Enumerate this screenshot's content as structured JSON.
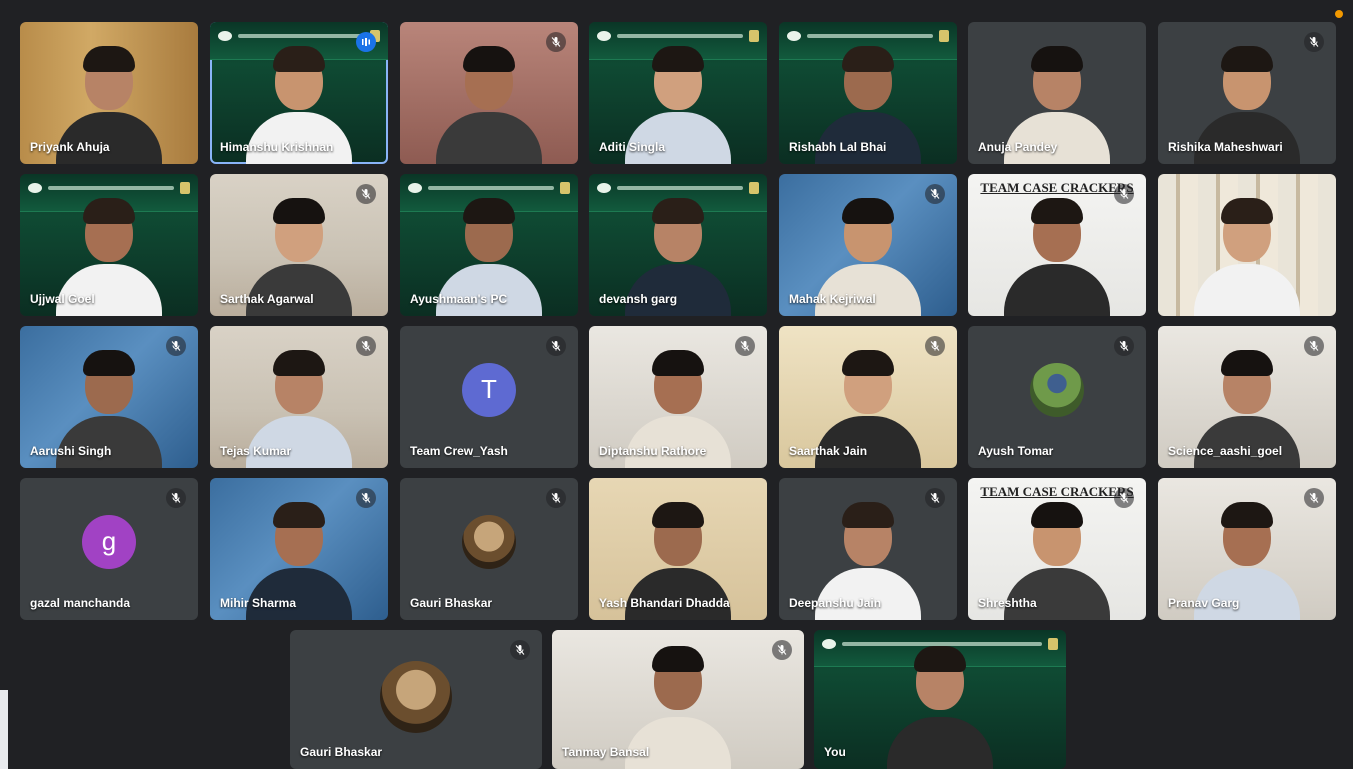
{
  "meeting": {
    "participants": [
      {
        "id": "p1",
        "name": "Priyank Ahuja",
        "bg": "wood",
        "muted": false
      },
      {
        "id": "p2",
        "name": "Himanshu Krishnan",
        "bg": "green",
        "muted": false,
        "active": true,
        "effect_icon": true
      },
      {
        "id": "p3",
        "name": "",
        "bg": "pink",
        "muted": true
      },
      {
        "id": "p4",
        "name": "Aditi Singla",
        "bg": "green",
        "muted": false
      },
      {
        "id": "p5",
        "name": "Rishabh Lal Bhai",
        "bg": "green",
        "muted": false
      },
      {
        "id": "p6",
        "name": "Anuja Pandey",
        "bg": "dark",
        "muted": false
      },
      {
        "id": "p7",
        "name": "Rishika Maheshwari",
        "bg": "dark",
        "muted": true
      },
      {
        "id": "p8",
        "name": "Ujjwal Goel",
        "bg": "green",
        "muted": false
      },
      {
        "id": "p9",
        "name": "Sarthak Agarwal",
        "bg": "room",
        "muted": true
      },
      {
        "id": "p10",
        "name": "Ayushmaan's PC",
        "bg": "green",
        "muted": false
      },
      {
        "id": "p11",
        "name": "devansh garg",
        "bg": "green",
        "muted": false
      },
      {
        "id": "p12",
        "name": "Mahak Kejriwal",
        "bg": "blue",
        "muted": true
      },
      {
        "id": "p13",
        "name": "",
        "bg": "white",
        "muted": true,
        "banner": "TEAM CASE CRACKERS"
      },
      {
        "id": "p14",
        "name": "",
        "bg": "shelf",
        "muted": false
      },
      {
        "id": "p15",
        "name": "Aarushi Singh",
        "bg": "blue",
        "muted": true
      },
      {
        "id": "p16",
        "name": "Tejas Kumar",
        "bg": "room",
        "muted": true
      },
      {
        "id": "p17",
        "name": "Team Crew_Yash",
        "bg": "dark",
        "muted": true,
        "initial": "T",
        "initial_color": "#5e6ad2"
      },
      {
        "id": "p18",
        "name": "Diptanshu Rathore",
        "bg": "office",
        "muted": true
      },
      {
        "id": "p19",
        "name": "Saarthak Jain",
        "bg": "gold",
        "muted": true
      },
      {
        "id": "p20",
        "name": "Ayush Tomar",
        "bg": "dark",
        "muted": true,
        "photo": "green"
      },
      {
        "id": "p21",
        "name": "Science_aashi_goel",
        "bg": "office",
        "muted": true
      },
      {
        "id": "p22",
        "name": "gazal manchanda",
        "bg": "dark",
        "muted": true,
        "initial": "g",
        "initial_color": "#a142c4"
      },
      {
        "id": "p23",
        "name": "Mihir Sharma",
        "bg": "blue",
        "muted": true
      },
      {
        "id": "p24",
        "name": "Gauri Bhaskar",
        "bg": "dark",
        "muted": true,
        "photo": "brown"
      },
      {
        "id": "p25",
        "name": "Yash Bhandari Dhadda",
        "bg": "warm",
        "muted": false
      },
      {
        "id": "p26",
        "name": "Deepanshu Jain",
        "bg": "dark",
        "muted": true
      },
      {
        "id": "p27",
        "name": "Shreshtha",
        "bg": "white",
        "muted": true,
        "banner": "TEAM CASE CRACKERS"
      },
      {
        "id": "p28",
        "name": "Pranav Garg",
        "bg": "office",
        "muted": true
      },
      {
        "id": "p29",
        "name": "Gauri Bhaskar",
        "bg": "dark",
        "muted": true,
        "photo": "brown"
      },
      {
        "id": "p30",
        "name": "Tanmay Bansal",
        "bg": "office",
        "muted": true
      },
      {
        "id": "p31",
        "name": "You",
        "bg": "green",
        "muted": false
      }
    ]
  }
}
